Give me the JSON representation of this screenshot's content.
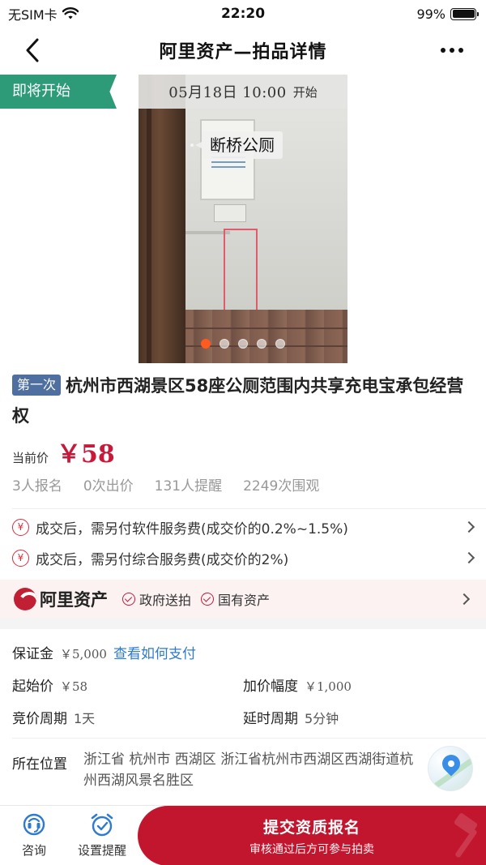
{
  "status_bar": {
    "carrier": "无SIM卡",
    "time": "22:20",
    "battery": "99%"
  },
  "nav": {
    "title": "阿里资产—拍品详情"
  },
  "hero": {
    "status_tag": "即将开始",
    "start_date": "05月18日 10:00",
    "start_suffix": "开始",
    "photo_label": "断桥公厕",
    "image_count": 5,
    "active_index": 0
  },
  "item": {
    "round_tag": "第一次",
    "title": "杭州市西湖景区58座公厕范围内共享充电宝承包经营权",
    "price_label": "当前价",
    "price": "￥58",
    "stats": [
      "3人报名",
      "0次出价",
      "131人提醒",
      "2249次围观"
    ]
  },
  "fees": [
    {
      "icon": "¥",
      "text": "成交后，需另付软件服务费(成交价的0.2%~1.5%)"
    },
    {
      "icon": "¥",
      "text": "成交后，需另付综合服务费(成交价的2%)"
    }
  ],
  "brand": {
    "name": "阿里资产",
    "badges": [
      "政府送拍",
      "国有资产"
    ]
  },
  "details": {
    "deposit_label": "保证金",
    "deposit_value": "￥5,000",
    "deposit_link": "查看如何支付",
    "start_price_label": "起始价",
    "start_price_value": "￥58",
    "increment_label": "加价幅度",
    "increment_value": "￥1,000",
    "period_label": "竞价周期",
    "period_value": "1天",
    "delay_label": "延时周期",
    "delay_value": "5分钟",
    "location_label": "所在位置",
    "location_value": "浙江省 杭州市 西湖区 浙江省杭州市西湖区西湖街道杭州西湖风景名胜区"
  },
  "bottom_bar": {
    "consult_label": "咨询",
    "reminder_label": "设置提醒",
    "cta_main": "提交资质报名",
    "cta_sub": "审核通过后方可参与拍卖"
  },
  "colors": {
    "accent": "#c2162f",
    "status_green": "#2d9a78",
    "link_blue": "#2e7ad1",
    "tag_blue": "#4e6fa0"
  }
}
